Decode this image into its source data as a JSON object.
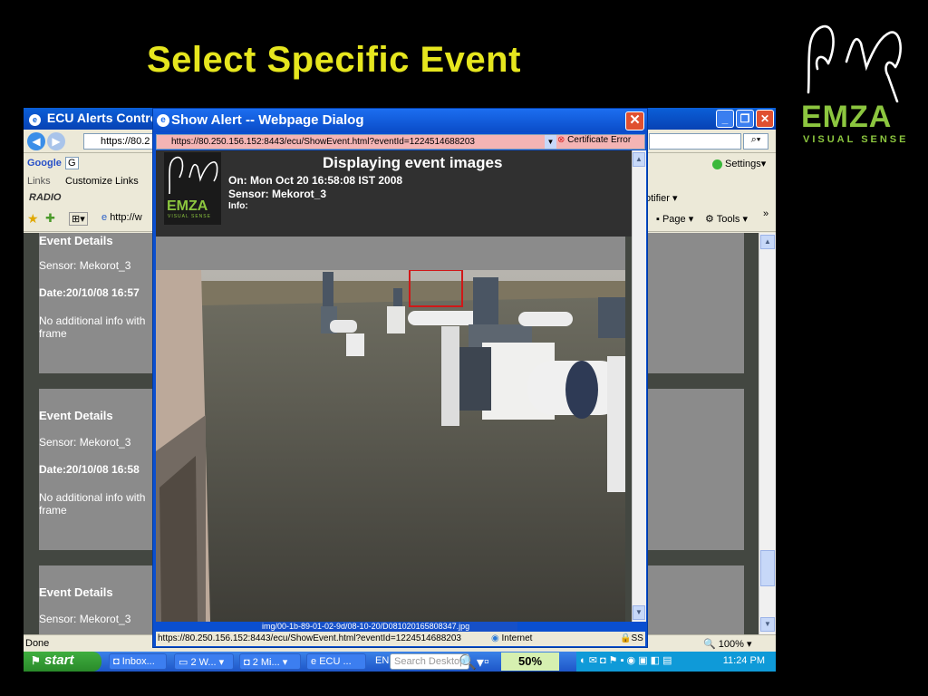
{
  "slide": {
    "title": "Select Specific Event"
  },
  "logo": {
    "word": "EMZA",
    "sub": "VISUAL SENSE",
    "brand_color": "#8cc63f"
  },
  "ie_window": {
    "title": "ECU Alerts Contro",
    "address": "https://80.2",
    "google_label": "Google",
    "google_dropdown": "G",
    "links_label": "Links",
    "customize_links": "Customize Links",
    "radio_label": "RADIO",
    "settings": "Settings",
    "notifier": "otifier",
    "tab_url": "http://w",
    "page_menu": "Page",
    "tools_menu": "Tools",
    "status": "Done",
    "zoom": "100%",
    "events": [
      {
        "header": "Event Details",
        "sensor": "Sensor: Mekorot_3",
        "date": "Date:20/10/08 16:57",
        "info_line1": "No additional info with",
        "info_line2": "frame"
      },
      {
        "header": "Event Details",
        "sensor": "Sensor: Mekorot_3",
        "date": "Date:20/10/08 16:58",
        "info_line1": "No additional info with",
        "info_line2": "frame"
      },
      {
        "header": "Event Details",
        "sensor": "Sensor: Mekorot_3"
      }
    ]
  },
  "dialog": {
    "title": "Show Alert -- Webpage Dialog",
    "address": "https://80.250.156.152:8443/ecu/ShowEvent.html?eventId=1224514688203",
    "cert_error": "Certificate Error",
    "heading": "Displaying event images",
    "on_line": "On: Mon Oct 20 16:58:08 IST 2008",
    "sensor_line": "Sensor: Mekorot_3",
    "info_line": "Info:",
    "mini_logo_word": "EMZA",
    "mini_logo_sub": "VISUAL SENSE",
    "image_path": "img/00-1b-89-01-02-9d/08-10-20/D081020165808347.jpg",
    "status_url": "https://80.250.156.152:8443/ecu/ShowEvent.html?eventId=1224514688203",
    "zone": "Internet",
    "ssl": "SS"
  },
  "taskbar": {
    "start": "start",
    "items": [
      "Inbox...",
      "2 W...",
      "2 Mi...",
      "ECU ..."
    ],
    "lang": "EN",
    "search": "Search Desktop",
    "percent": "50%",
    "clock": "11:24 PM"
  },
  "colors": {
    "title_yellow": "#e6e61e",
    "xp_blue": "#0a4fd0"
  }
}
